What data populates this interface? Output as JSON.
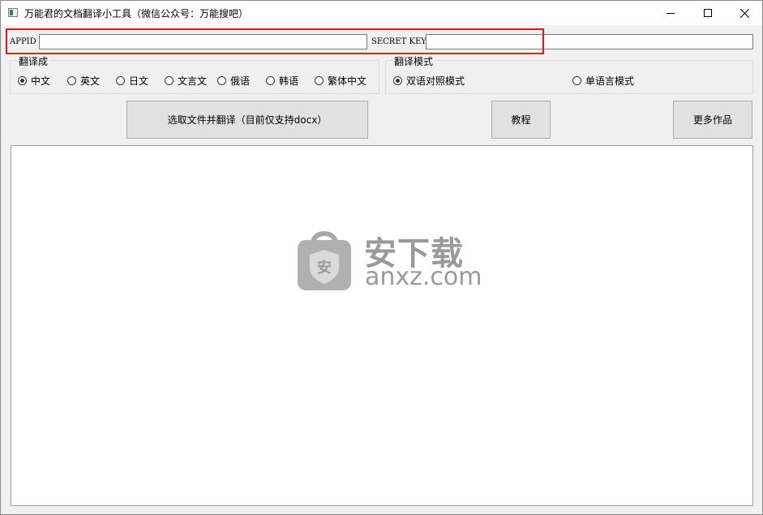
{
  "window": {
    "title": "万能君的文档翻译小工具（微信公众号：万能搜吧）",
    "minimize_icon": "minimize-icon",
    "maximize_icon": "maximize-icon",
    "close_icon": "close-icon"
  },
  "credentials": {
    "appid_label": "APPID",
    "appid_value": "",
    "secret_label": "SECRET KEY",
    "secret_value": "",
    "highlight_color": "#e8141b"
  },
  "target_language": {
    "title": "翻译成",
    "selected": "中文",
    "options": [
      "中文",
      "英文",
      "日文",
      "文言文",
      "俄语",
      "韩语",
      "繁体中文"
    ]
  },
  "translation_mode": {
    "title": "翻译模式",
    "selected": "双语对照模式",
    "options": [
      "双语对照模式",
      "单语言模式"
    ]
  },
  "buttons": {
    "select_file": "选取文件并翻译（目前仅支持docx）",
    "tutorial": "教程",
    "more_works": "更多作品"
  },
  "output": {
    "content": "",
    "watermark_cn": "安下载",
    "watermark_en": "anxz.com",
    "watermark_icon": "shield-bag-icon"
  }
}
